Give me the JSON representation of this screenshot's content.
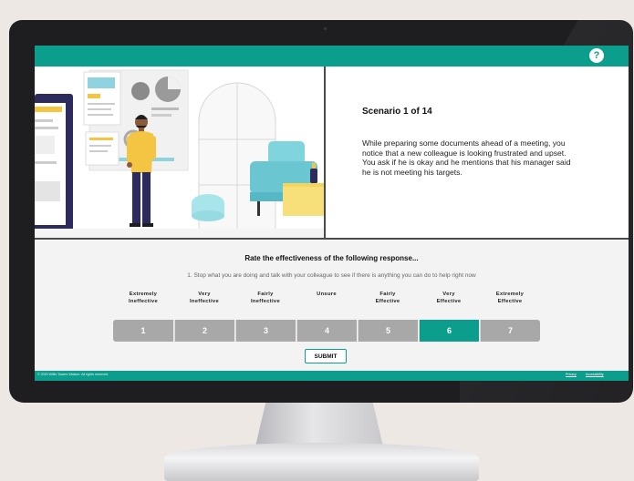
{
  "header": {
    "help_label": "?"
  },
  "scenario": {
    "title": "Scenario 1 of 14",
    "text": "While preparing some documents ahead of a meeting, you notice that a new colleague is looking frustrated and upset. You ask if he is okay and he mentions that his manager said he is not meeting his targets."
  },
  "question": {
    "prompt": "Rate the effectiveness of the following response...",
    "response": "1. Stop what you are doing and talk with your colleague to see if there is anything you can do to help right now"
  },
  "scale": {
    "labels": [
      [
        "Extremely",
        "Ineffective"
      ],
      [
        "Very",
        "Ineffective"
      ],
      [
        "Fairly",
        "Ineffective"
      ],
      [
        "Unsure",
        ""
      ],
      [
        "Fairly",
        "Effective"
      ],
      [
        "Very",
        "Effective"
      ],
      [
        "Extremely",
        "Effective"
      ]
    ],
    "options": [
      "1",
      "2",
      "3",
      "4",
      "5",
      "6",
      "7"
    ],
    "selected": "6"
  },
  "actions": {
    "submit_label": "SUBMIT"
  },
  "footer": {
    "copyright": "© 2020 Willis Towers Watson. All rights reserved.",
    "privacy": "Privacy",
    "accessibility": "Accessibility"
  },
  "colors": {
    "accent": "#0b9e8c",
    "button_gray": "#a8a8a8"
  },
  "icons": {
    "help": "question-mark-icon"
  }
}
